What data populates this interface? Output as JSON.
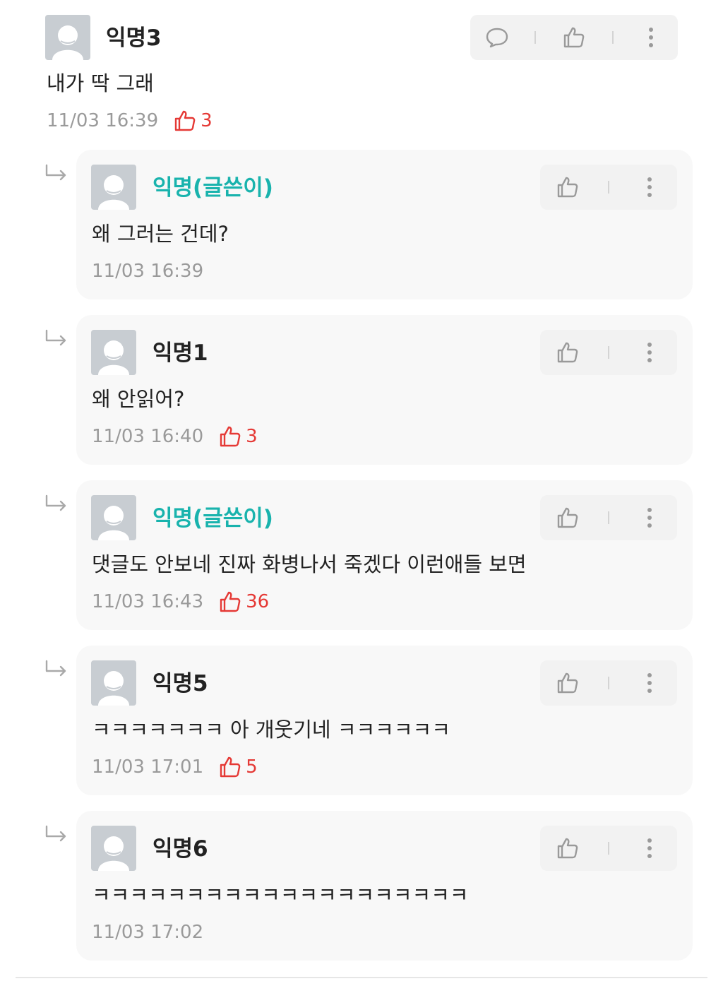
{
  "comment": {
    "name": "익명3",
    "text": "내가 딱 그래",
    "time": "11/03 16:39",
    "likes": "3"
  },
  "replies": [
    {
      "name": "익명(글쓴이)",
      "author": true,
      "text": "왜 그러는 건데?",
      "time": "11/03 16:39",
      "likes": ""
    },
    {
      "name": "익명1",
      "author": false,
      "text": "왜 안읽어?",
      "time": "11/03 16:40",
      "likes": "3"
    },
    {
      "name": "익명(글쓴이)",
      "author": true,
      "text": "댓글도 안보네 진짜 화병나서 죽겠다 이런애들 보면",
      "time": "11/03 16:43",
      "likes": "36"
    },
    {
      "name": "익명5",
      "author": false,
      "text": "ㅋㅋㅋㅋㅋㅋㅋ 아 개웃기네 ㅋㅋㅋㅋㅋㅋ",
      "time": "11/03 17:01",
      "likes": "5"
    },
    {
      "name": "익명6",
      "author": false,
      "text": "ㅋㅋㅋㅋㅋㅋㅋㅋㅋㅋㅋㅋㅋㅋㅋㅋㅋㅋㅋㅋ",
      "time": "11/03 17:02",
      "likes": ""
    }
  ],
  "colors": {
    "author_name": "#19b3ad",
    "vote_red": "#e53935",
    "card_bg": "#f8f8f8",
    "action_bg": "#f2f2f2"
  },
  "icons": {
    "comment": "speech-bubble-icon",
    "like": "thumbs-up-icon",
    "more": "vertical-dots-icon",
    "reply": "reply-arrow-icon"
  }
}
